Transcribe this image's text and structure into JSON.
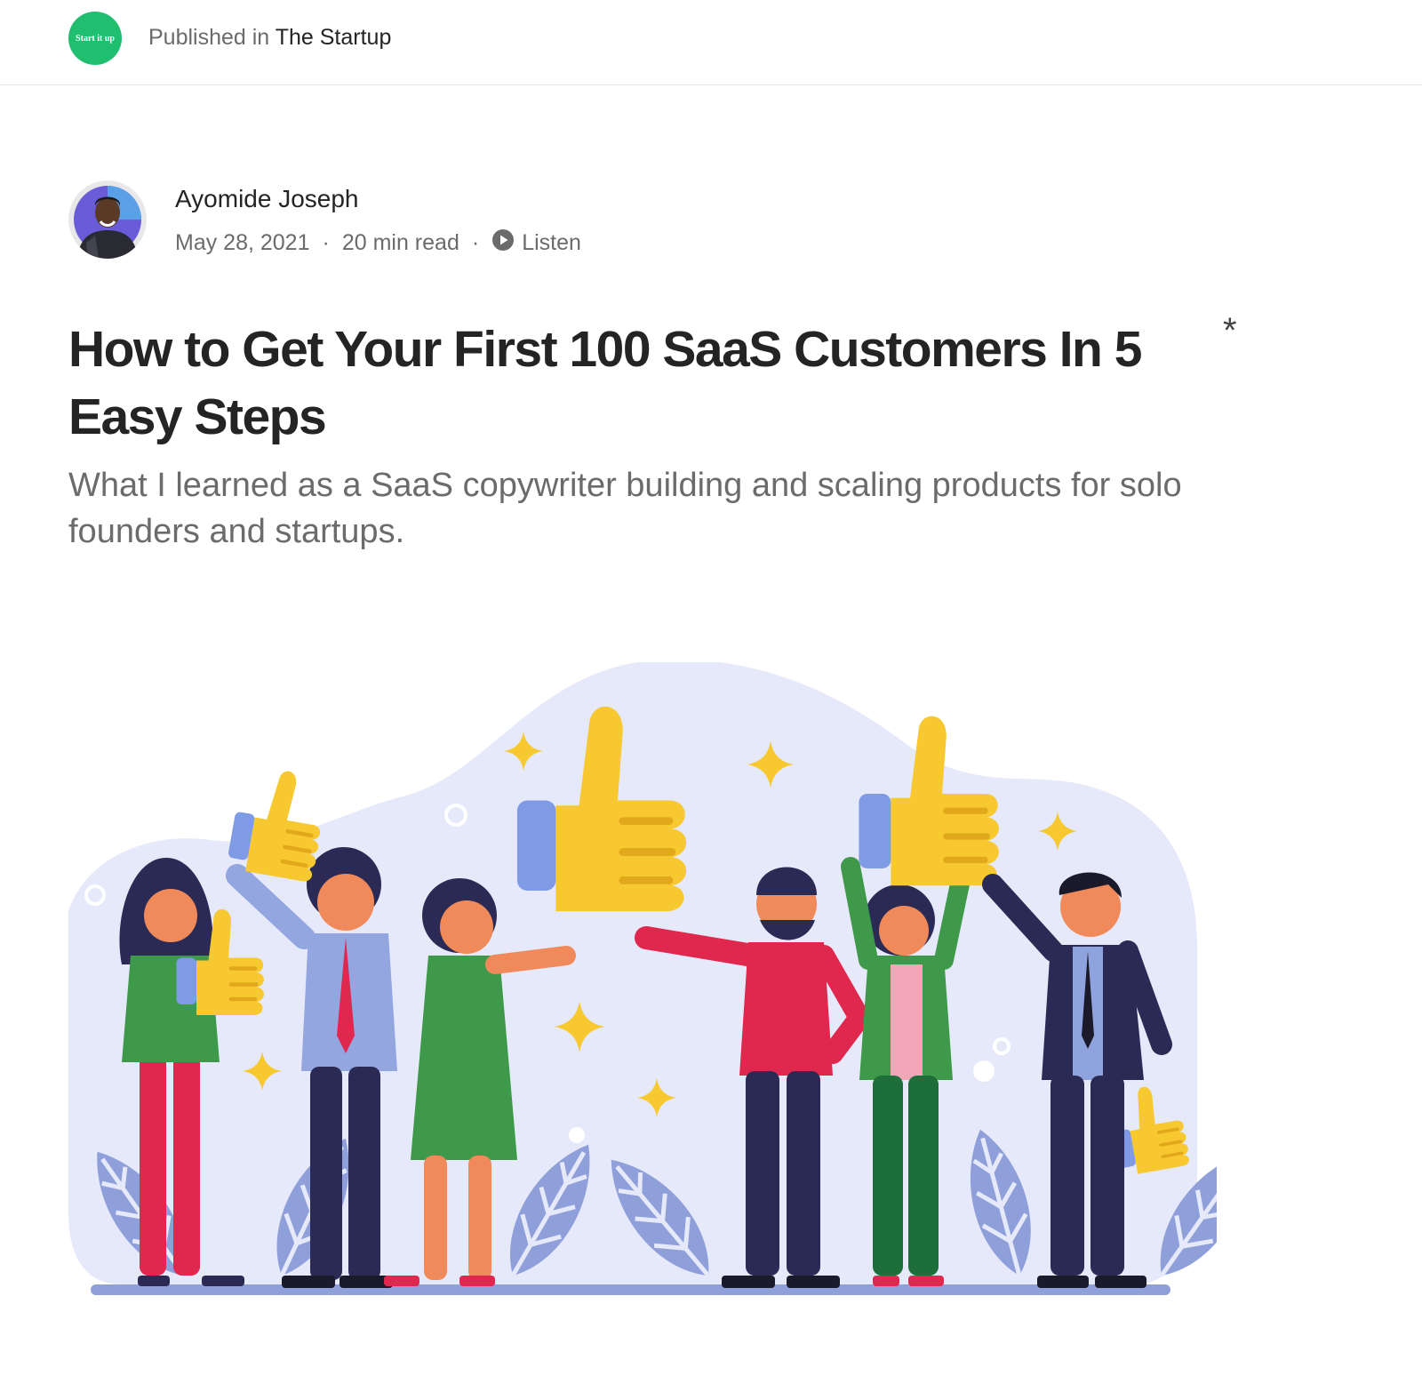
{
  "publication": {
    "logo_text": "Start it up",
    "published_prefix": "Published in",
    "name": "The Startup",
    "brand_color": "#1fbf6f"
  },
  "author": {
    "name": "Ayomide Joseph",
    "date": "May 28, 2021",
    "read_time": "20 min read",
    "separator": "·",
    "listen_label": "Listen",
    "listen_icon": "play-circle-icon"
  },
  "article": {
    "title": "How to Get Your First 100 SaaS Customers In 5 Easy Steps",
    "subtitle": "What I learned as a SaaS copywriter building and scaling products for solo founders and startups.",
    "member_only_marker": "*"
  },
  "hero_image": {
    "icon": "people-thumbs-up-illustration-icon",
    "colors": {
      "background_blob": "#e6e9fa",
      "thumb": "#f7c830",
      "cuff": "#7f9be6",
      "leaf": "#8f9fd9"
    }
  }
}
